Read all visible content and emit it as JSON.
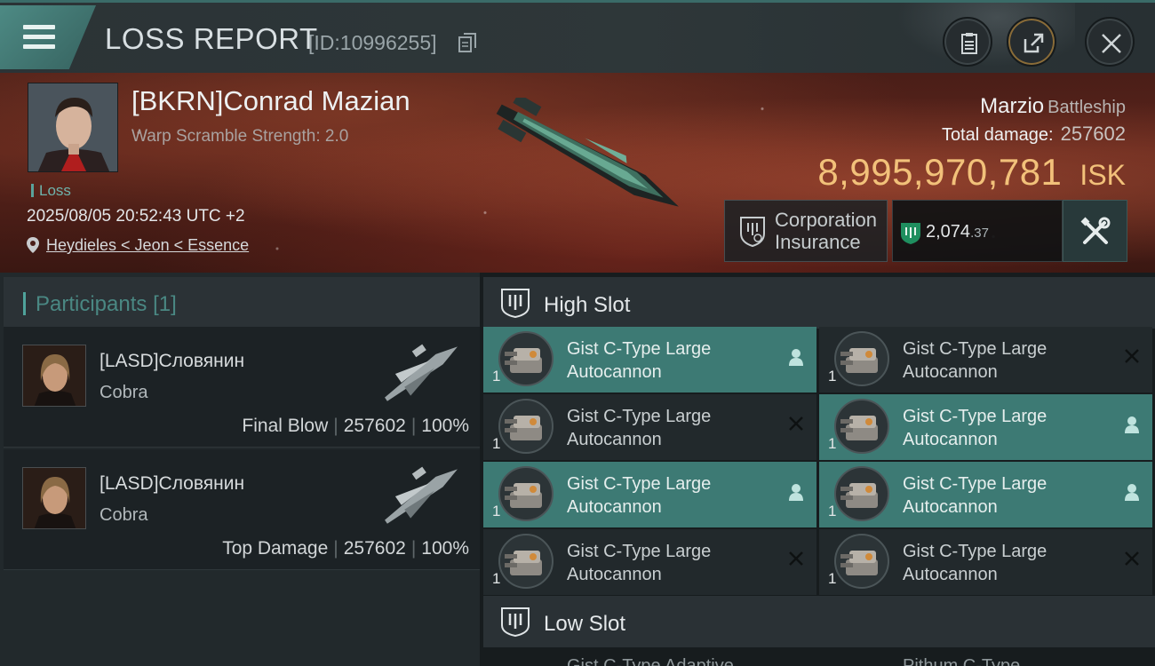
{
  "header": {
    "title": "LOSS REPORT",
    "report_id": "[ID:10996255]",
    "icons": [
      "menu-icon",
      "copy-icon",
      "clipboard-icon",
      "share-icon",
      "close-icon"
    ]
  },
  "victim": {
    "name": "[BKRN]Conrad Mazian",
    "scramble_label": "Warp Scramble Strength: 2.0",
    "status": "Loss",
    "timestamp": "2025/08/05 20:52:43 UTC +2",
    "location": "Heydieles < Jeon < Essence",
    "ship_name": "Marzio",
    "ship_class": "Battleship",
    "damage_label": "Total damage:",
    "total_damage": "257602",
    "isk_value": "8,995,970,781",
    "isk_unit": "ISK",
    "insurance_label_1": "Corporation",
    "insurance_label_2": "Insurance",
    "payout_int": "2,074",
    "payout_dec": ".37"
  },
  "participants": {
    "label": "Participants",
    "count": "[1]",
    "rows": [
      {
        "name": "[LASD]Словянин",
        "ship": "Cobra",
        "role": "Final Blow",
        "damage": "257602",
        "percent": "100%"
      },
      {
        "name": "[LASD]Словянин",
        "ship": "Cobra",
        "role": "Top Damage",
        "damage": "257602",
        "percent": "100%"
      }
    ]
  },
  "slots": {
    "high_label": "High Slot",
    "low_label": "Low Slot",
    "high_modules": [
      {
        "line1": "Gist C-Type Large",
        "line2": "Autocannon",
        "qty": "1",
        "state": "dropped"
      },
      {
        "line1": "Gist C-Type Large",
        "line2": "Autocannon",
        "qty": "1",
        "state": "destroyed"
      },
      {
        "line1": "Gist C-Type Large",
        "line2": "Autocannon",
        "qty": "1",
        "state": "destroyed"
      },
      {
        "line1": "Gist C-Type Large",
        "line2": "Autocannon",
        "qty": "1",
        "state": "dropped"
      },
      {
        "line1": "Gist C-Type Large",
        "line2": "Autocannon",
        "qty": "1",
        "state": "dropped"
      },
      {
        "line1": "Gist C-Type Large",
        "line2": "Autocannon",
        "qty": "1",
        "state": "dropped"
      },
      {
        "line1": "Gist C-Type Large",
        "line2": "Autocannon",
        "qty": "1",
        "state": "destroyed"
      },
      {
        "line1": "Gist C-Type Large",
        "line2": "Autocannon",
        "qty": "1",
        "state": "destroyed"
      }
    ],
    "low_peek": [
      "Gist C-Type Adaptive",
      "Pithum C-Type"
    ]
  },
  "colors": {
    "accent_teal": "#3d7a74",
    "isk_gold": "#f2c17a",
    "banner_red": "#5b241b"
  }
}
